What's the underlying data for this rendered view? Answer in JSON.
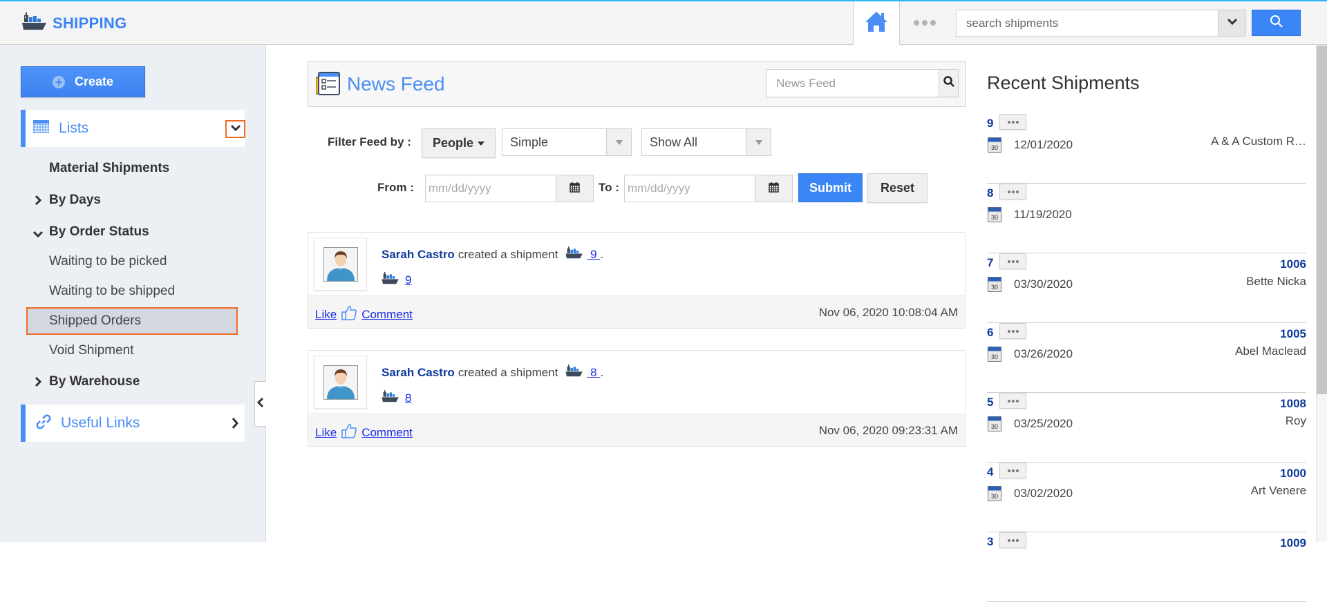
{
  "header": {
    "app_title": "SHIPPING",
    "search_placeholder": "search shipments",
    "icons": {
      "logo": "ship-icon",
      "home": "home-icon",
      "more": "more-dots-icon",
      "search": "search-icon",
      "dropdown": "chevron-down-icon"
    }
  },
  "colors": {
    "accent": "#4a8ef5",
    "primary_button": "#3b86f7",
    "highlight_border": "#f36b21",
    "link_dark": "#0d3a9c",
    "link": "#1a2ce8",
    "sidebar_bg": "#eceff4",
    "top_bar_line": "#29b6f6"
  },
  "sidebar": {
    "create_label": "Create",
    "lists_label": "Lists",
    "items": [
      {
        "label": "Material Shipments",
        "bold": true,
        "chevron": ""
      },
      {
        "label": "By Days",
        "bold": true,
        "chevron": "right"
      },
      {
        "label": "By Order Status",
        "bold": true,
        "chevron": "down"
      },
      {
        "label": "Waiting to be picked",
        "bold": false
      },
      {
        "label": "Waiting to be shipped",
        "bold": false
      },
      {
        "label": "Shipped Orders",
        "bold": false,
        "selected": true
      },
      {
        "label": "Void Shipment",
        "bold": false
      },
      {
        "label": "By Warehouse",
        "bold": true,
        "chevron": "right"
      }
    ],
    "useful_links_label": "Useful Links"
  },
  "newsfeed": {
    "title": "News Feed",
    "search_placeholder": "News Feed",
    "filter_label": "Filter Feed by :",
    "people_label": "People",
    "type_select": "Simple",
    "show_select": "Show All",
    "from_label": "From :",
    "to_label": "To :",
    "date_placeholder": "mm/dd/yyyy",
    "submit_label": "Submit",
    "reset_label": "Reset",
    "items": [
      {
        "user": "Sarah Castro",
        "action": "created a shipment",
        "shipment": "9",
        "period": ".",
        "like": "Like",
        "comment": "Comment",
        "timestamp": "Nov 06, 2020 10:08:04 AM"
      },
      {
        "user": "Sarah Castro",
        "action": "created a shipment",
        "shipment": "8",
        "period": ".",
        "like": "Like",
        "comment": "Comment",
        "timestamp": "Nov 06, 2020 09:23:31 AM"
      }
    ]
  },
  "recent": {
    "title": "Recent Shipments",
    "calendar_day": "30",
    "items": [
      {
        "num": "9",
        "date": "12/01/2020",
        "ref": "",
        "customer": "A & A Custom R…"
      },
      {
        "num": "8",
        "date": "11/19/2020",
        "ref": "",
        "customer": ""
      },
      {
        "num": "7",
        "date": "03/30/2020",
        "ref": "1006",
        "customer": "Bette Nicka"
      },
      {
        "num": "6",
        "date": "03/26/2020",
        "ref": "1005",
        "customer": "Abel Maclead"
      },
      {
        "num": "5",
        "date": "03/25/2020",
        "ref": "1008",
        "customer": "Roy"
      },
      {
        "num": "4",
        "date": "03/02/2020",
        "ref": "1000",
        "customer": "Art Venere"
      },
      {
        "num": "3",
        "date": "",
        "ref": "1009",
        "customer": ""
      }
    ]
  }
}
